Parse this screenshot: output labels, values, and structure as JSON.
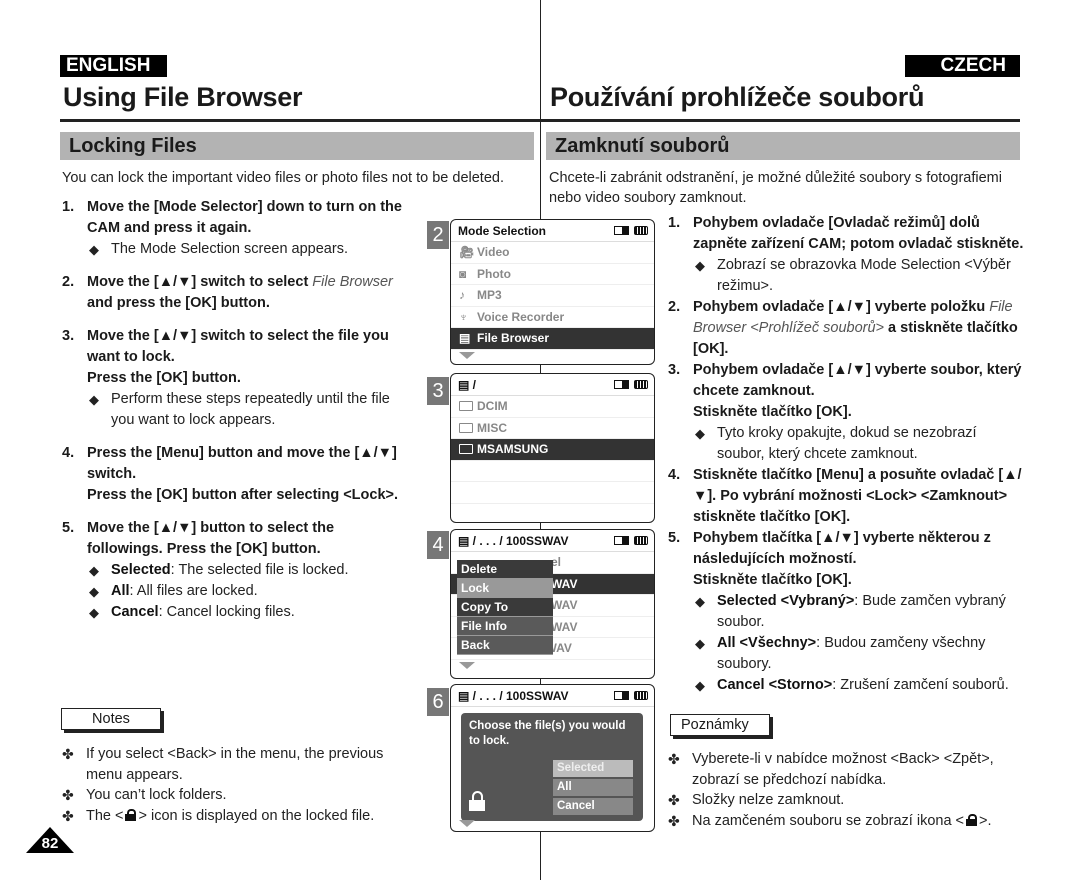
{
  "header": {
    "lang_en": "ENGLISH",
    "lang_cz": "CZECH",
    "title_en": "Using File Browser",
    "title_cz": "Používání prohlížeče souborů",
    "section_en": "Locking Files",
    "section_cz": "Zamknutí souborů"
  },
  "intro": {
    "en": "You can lock the important video files or photo files not to be deleted.",
    "cz": "Chcete-li zabránit odstranění, je možné důležité soubory s fotografiemi nebo video soubory zamknout."
  },
  "steps_en": [
    {
      "num": "1.",
      "text": "Move the [Mode Selector] down to turn on the CAM and press it again.",
      "subs": [
        {
          "text": "The Mode Selection screen appears."
        }
      ]
    },
    {
      "num": "2.",
      "pre": "Move the [▲/▼] switch to select ",
      "italic": "File Browser",
      "post": " and press the [OK] button."
    },
    {
      "num": "3.",
      "text": "Move the [▲/▼] switch to select the file you want to lock.",
      "text2": "Press the [OK] button.",
      "subs": [
        {
          "text": "Perform these steps repeatedly until the file you want to lock appears."
        }
      ]
    },
    {
      "num": "4.",
      "text": "Press the [Menu] button and move the [▲/▼] switch.",
      "text2": "Press the [OK] button after selecting <Lock>."
    },
    {
      "num": "5.",
      "text": "Move the [▲/▼] button to select the followings. Press the [OK] button.",
      "subs": [
        {
          "bold": "Selected",
          "text": ": The selected file is locked."
        },
        {
          "bold": "All",
          "text": ": All files are locked."
        },
        {
          "bold": "Cancel",
          "text": ": Cancel locking files."
        }
      ]
    }
  ],
  "steps_cz": [
    {
      "num": "1.",
      "text": "Pohybem ovladače [Ovladač režimů] dolů zapněte zařízení CAM; potom ovladač stiskněte.",
      "subs": [
        {
          "text": "Zobrazí se obrazovka Mode Selection <Výběr režimu>."
        }
      ]
    },
    {
      "num": "2.",
      "pre": "Pohybem ovladače [▲/▼] vyberte položku ",
      "italic": "File Browser <Prohlížeč souborů>",
      "post": " a stiskněte tlačítko [OK]."
    },
    {
      "num": "3.",
      "text": "Pohybem ovladače [▲/▼] vyberte soubor, který chcete zamknout.",
      "text2": "Stiskněte tlačítko [OK].",
      "subs": [
        {
          "text": "Tyto kroky opakujte, dokud se nezobrazí soubor, který chcete zamknout."
        }
      ]
    },
    {
      "num": "4.",
      "text": "Stiskněte tlačítko [Menu] a posuňte ovladač [▲/▼]. Po vybrání možnosti <Lock> <Zamknout> stiskněte tlačítko [OK]."
    },
    {
      "num": "5.",
      "text": "Pohybem tlačítka [▲/▼] vyberte některou z následujících možností.",
      "text2": "Stiskněte tlačítko [OK].",
      "subs": [
        {
          "bold": "Selected <Vybraný>",
          "text": ": Bude zamčen vybraný soubor."
        },
        {
          "bold": "All <Všechny>",
          "text": ": Budou zamčeny všechny soubory."
        },
        {
          "bold": "Cancel <Storno>",
          "text": ": Zrušení zamčení souborů."
        }
      ]
    }
  ],
  "notes_en": {
    "label": "Notes",
    "items": [
      {
        "text": "If you select <Back> in the menu, the previous menu appears."
      },
      {
        "text": "You can’t lock folders."
      },
      {
        "pre": "The <",
        "post": "> icon is displayed on the locked file.",
        "icon": "lock-icon"
      }
    ]
  },
  "notes_cz": {
    "label": "Poznámky",
    "items": [
      {
        "text": "Vyberete-li v nabídce možnost <Back> <Zpět>, zobrazí se předchozí nabídka."
      },
      {
        "text": "Složky nelze zamknout."
      },
      {
        "pre": "Na zamčeném souboru se zobrazí ikona <",
        "post": ">.",
        "icon": "lock-icon"
      }
    ]
  },
  "page_number": "82",
  "screens": {
    "s2": {
      "num": "2",
      "title": "Mode Selection",
      "items": [
        {
          "icon": "video-camera-icon",
          "label": "Video"
        },
        {
          "icon": "camera-icon",
          "label": "Photo"
        },
        {
          "icon": "music-note-icon",
          "label": "MP3"
        },
        {
          "icon": "microphone-icon",
          "label": "Voice Recorder"
        },
        {
          "icon": "file-icon",
          "label": "File Browser",
          "selected": true
        }
      ]
    },
    "s3": {
      "num": "3",
      "path": "/",
      "items": [
        {
          "label": "DCIM"
        },
        {
          "label": "MISC"
        },
        {
          "label": "MSAMSUNG",
          "selected": true
        }
      ]
    },
    "s4": {
      "num": "4",
      "path": "/ . . . / 100SSWAV",
      "bg_items": [
        "el",
        "WAV",
        "WAV",
        "WAV",
        "SWAV0004.WAV"
      ],
      "menu": [
        "Delete",
        "Lock",
        "Copy To",
        "File Info",
        "Back"
      ],
      "menu_highlight": "Lock"
    },
    "s6": {
      "num": "6",
      "path": "/ . . . / 100SSWAV",
      "message": "Choose the file(s) you would to lock.",
      "options": [
        "Selected",
        "All",
        "Cancel"
      ],
      "selected_option": "Selected"
    }
  }
}
